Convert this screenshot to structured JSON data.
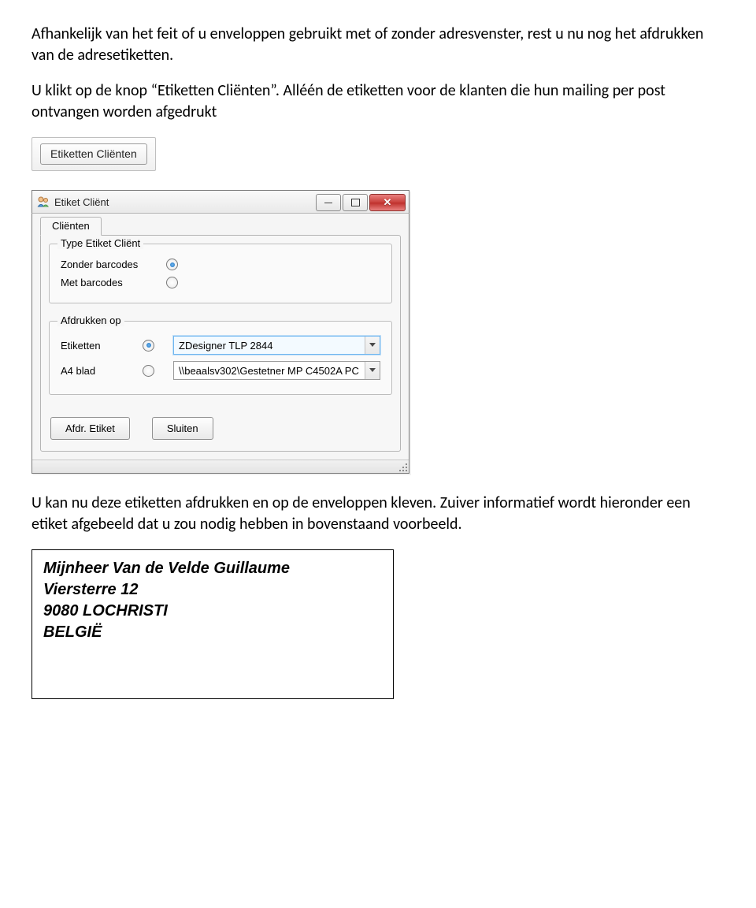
{
  "doc": {
    "para1": "Afhankelijk van het feit of u enveloppen gebruikt met of zonder adresvenster, rest u nu nog het afdrukken van de adresetiketten.",
    "para2": "U klikt  op de knop “Etiketten Cliënten”. Alléén de etiketten voor de klanten die hun mailing per post ontvangen worden afgedrukt",
    "para3": "U kan nu deze etiketten afdrukken en op de enveloppen kleven. Zuiver informatief wordt hieronder een etiket afgebeeld dat u zou nodig hebben in bovenstaand voorbeeld."
  },
  "toolbar": {
    "etiketten_clienten_label": "Etiketten Cliënten"
  },
  "window": {
    "title": "Etiket Cliënt",
    "tab_label": "Cliënten",
    "group_type_label": "Type Etiket Cliënt",
    "opt_zonder_label": "Zonder barcodes",
    "opt_met_label": "Met barcodes",
    "group_afdrukken_label": "Afdrukken op",
    "opt_etiketten_label": "Etiketten",
    "opt_a4_label": "A4 blad",
    "combo_etiketten_value": "ZDesigner TLP 2844",
    "combo_a4_value": "\\\\beaalsv302\\Gestetner MP C4502A PC",
    "btn_afdr_label": "Afdr. Etiket",
    "btn_sluiten_label": "Sluiten"
  },
  "etiket": {
    "line1": "Mijnheer Van de Velde Guillaume",
    "line2": "Viersterre 12",
    "line3": "9080 LOCHRISTI",
    "line4": "BELGIË"
  }
}
